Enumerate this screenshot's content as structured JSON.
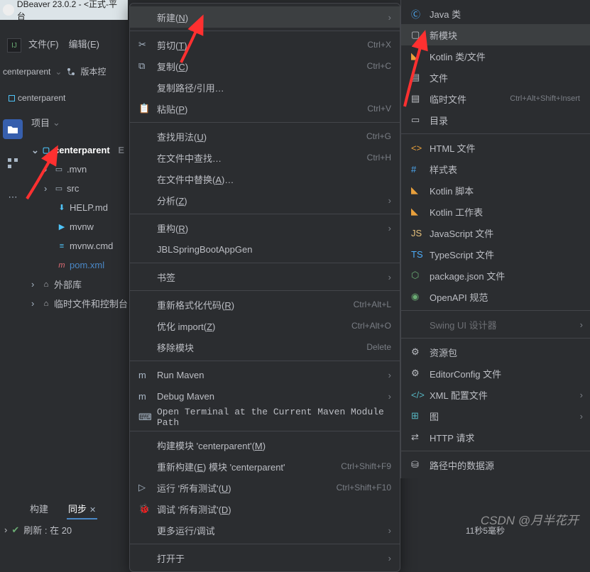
{
  "titlebar": "DBeaver 23.0.2 -  <正式-平台",
  "menubar": {
    "file": "文件(F)",
    "edit": "编辑(E)"
  },
  "breadcrumb": {
    "centerparent": "centerparent",
    "version": "版本控"
  },
  "centerparent_label": "centerparent",
  "project_header": "项目",
  "tree": {
    "root": "centerparent",
    "root_suffix": "E",
    "mvn": ".mvn",
    "src": "src",
    "help": "HELP.md",
    "mvnw": "mvnw",
    "mvnwcmd": "mvnw.cmd",
    "pom": "pom.xml",
    "ext": "外部库",
    "scratch": "临时文件和控制台"
  },
  "ctx": {
    "new": "新建(",
    "new_u": "N",
    "new2": ")",
    "cut": "剪切(",
    "cut_u": "T",
    "cut2": ")",
    "cut_sc": "Ctrl+X",
    "copy": "复制(",
    "copy_u": "C",
    "copy2": ")",
    "copy_sc": "Ctrl+C",
    "copypath": "复制路径/引用…",
    "paste": "粘贴(",
    "paste_u": "P",
    "paste2": ")",
    "paste_sc": "Ctrl+V",
    "findusages": "查找用法(",
    "findusages_u": "U",
    "findusages2": ")",
    "findusages_sc": "Ctrl+G",
    "findinfiles": "在文件中查找…",
    "findinfiles_sc": "Ctrl+H",
    "replaceinfiles": "在文件中替换(",
    "replaceinfiles_u": "A",
    "replaceinfiles2": ")…",
    "analyze": "分析(",
    "analyze_u": "Z",
    "analyze2": ")",
    "refactor": "重构(",
    "refactor_u": "R",
    "refactor2": ")",
    "jblgen": "JBLSpringBootAppGen",
    "bookmark": "书签",
    "reformat": "重新格式化代码(",
    "reformat_u": "R",
    "reformat2": ")",
    "reformat_sc": "Ctrl+Alt+L",
    "optimize": "优化 import(",
    "optimize_u": "Z",
    "optimize2": ")",
    "optimize_sc": "Ctrl+Alt+O",
    "removemod": "移除模块",
    "removemod_sc": "Delete",
    "runmaven": "Run Maven",
    "debugmaven": "Debug Maven",
    "openterm": "Open Terminal at the Current Maven Module Path",
    "buildmod": "构建模块 'centerparent'(",
    "buildmod_u": "M",
    "buildmod2": ")",
    "rebuild": "重新构建(",
    "rebuild_u": "E",
    "rebuild2": ") 模块 'centerparent'",
    "rebuild_sc": "Ctrl+Shift+F9",
    "run": "运行 '所有测试'(",
    "run_u": "U",
    "run2": ")",
    "run_sc": "Ctrl+Shift+F10",
    "debug": "调试 '所有测试'(",
    "debug_u": "D",
    "debug2": ")",
    "more": "更多运行/调试",
    "openin": "打开于"
  },
  "sub": {
    "javaclass": "Java 类",
    "module": "新模块",
    "kotlin": "Kotlin 类/文件",
    "file": "文件",
    "scratch": "临时文件",
    "scratch_sc": "Ctrl+Alt+Shift+Insert",
    "dir": "目录",
    "html": "HTML 文件",
    "css": "样式表",
    "kscript": "Kotlin 脚本",
    "kws": "Kotlin 工作表",
    "js": "JavaScript 文件",
    "ts": "TypeScript 文件",
    "pkgjson": "package.json 文件",
    "openapi": "OpenAPI 规范",
    "swing": "Swing UI 设计器",
    "resbundle": "资源包",
    "editorconfig": "EditorConfig 文件",
    "xml": "XML 配置文件",
    "graph": "图",
    "http": "HTTP 请求",
    "datasource": "路径中的数据源"
  },
  "bottom": {
    "build": "构建",
    "sync": "同步"
  },
  "status": "刷新 : 在  20",
  "status_time": "11秒5毫秒",
  "watermark": "CSDN @月半花开"
}
